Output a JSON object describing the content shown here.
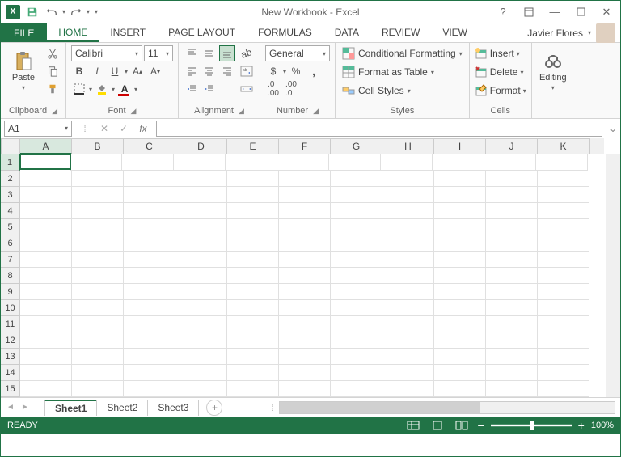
{
  "app": {
    "title": "New Workbook - Excel"
  },
  "user": {
    "name": "Javier Flores"
  },
  "tabs": {
    "file": "FILE",
    "list": [
      "HOME",
      "INSERT",
      "PAGE LAYOUT",
      "FORMULAS",
      "DATA",
      "REVIEW",
      "VIEW"
    ],
    "active": "HOME"
  },
  "ribbon": {
    "clipboard": {
      "paste": "Paste",
      "label": "Clipboard"
    },
    "font": {
      "name": "Calibri",
      "size": "11",
      "label": "Font"
    },
    "alignment": {
      "label": "Alignment"
    },
    "number": {
      "format": "General",
      "label": "Number"
    },
    "styles": {
      "conditional": "Conditional Formatting",
      "table": "Format as Table",
      "cell": "Cell Styles",
      "label": "Styles"
    },
    "cells": {
      "insert": "Insert",
      "delete": "Delete",
      "format": "Format",
      "label": "Cells"
    },
    "editing": {
      "label": "Editing"
    }
  },
  "namebox": "A1",
  "columns": [
    "A",
    "B",
    "C",
    "D",
    "E",
    "F",
    "G",
    "H",
    "I",
    "J",
    "K"
  ],
  "rows": [
    1,
    2,
    3,
    4,
    5,
    6,
    7,
    8,
    9,
    10,
    11,
    12,
    13,
    14,
    15
  ],
  "activeCell": {
    "row": 1,
    "col": "A"
  },
  "sheets": {
    "list": [
      "Sheet1",
      "Sheet2",
      "Sheet3"
    ],
    "active": "Sheet1"
  },
  "status": {
    "ready": "READY",
    "zoom": "100%"
  }
}
